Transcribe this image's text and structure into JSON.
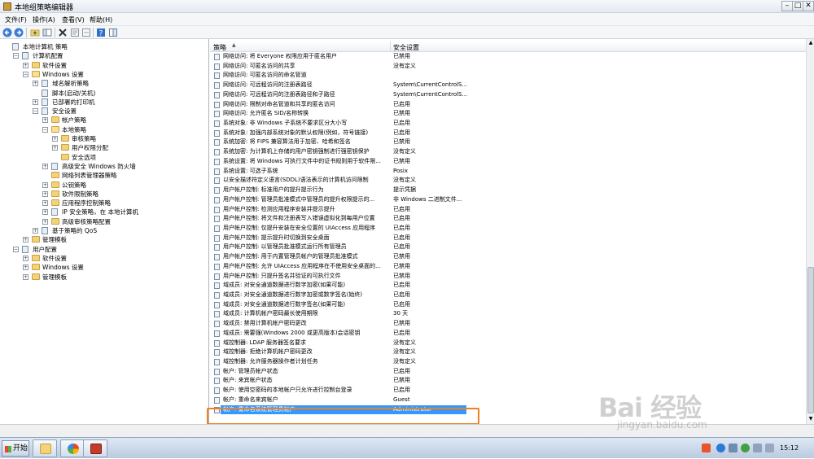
{
  "window": {
    "title": "本地组策略编辑器"
  },
  "menu": [
    "文件(F)",
    "操作(A)",
    "查看(V)",
    "帮助(H)"
  ],
  "tree": [
    {
      "label": "本地计算机 策略",
      "level": 0,
      "exp": "",
      "icon": "computer"
    },
    {
      "label": "计算机配置",
      "level": 1,
      "exp": "-",
      "icon": "computer"
    },
    {
      "label": "软件设置",
      "level": 2,
      "exp": "+",
      "icon": "folder"
    },
    {
      "label": "Windows 设置",
      "level": 2,
      "exp": "-",
      "icon": "folder-open"
    },
    {
      "label": "域名解析策略",
      "level": 3,
      "exp": "+",
      "icon": "gen"
    },
    {
      "label": "脚本(启动/关机)",
      "level": 3,
      "exp": "",
      "icon": "gen"
    },
    {
      "label": "已部署的打印机",
      "level": 3,
      "exp": "+",
      "icon": "gen"
    },
    {
      "label": "安全设置",
      "level": 3,
      "exp": "-",
      "icon": "gen"
    },
    {
      "label": "帐户策略",
      "level": 4,
      "exp": "+",
      "icon": "folder"
    },
    {
      "label": "本地策略",
      "level": 4,
      "exp": "-",
      "icon": "folder-open"
    },
    {
      "label": "审核策略",
      "level": 5,
      "exp": "+",
      "icon": "folder"
    },
    {
      "label": "用户权限分配",
      "level": 5,
      "exp": "+",
      "icon": "folder"
    },
    {
      "label": "安全选项",
      "level": 5,
      "exp": "",
      "icon": "folder"
    },
    {
      "label": "高级安全 Windows 防火墙",
      "level": 4,
      "exp": "+",
      "icon": "gen"
    },
    {
      "label": "网络列表管理器策略",
      "level": 4,
      "exp": "",
      "icon": "folder"
    },
    {
      "label": "公钥策略",
      "level": 4,
      "exp": "+",
      "icon": "folder"
    },
    {
      "label": "软件限制策略",
      "level": 4,
      "exp": "+",
      "icon": "folder"
    },
    {
      "label": "应用程序控制策略",
      "level": 4,
      "exp": "+",
      "icon": "folder"
    },
    {
      "label": "IP 安全策略，在 本地计算机",
      "level": 4,
      "exp": "+",
      "icon": "gen"
    },
    {
      "label": "高级审核策略配置",
      "level": 4,
      "exp": "+",
      "icon": "folder"
    },
    {
      "label": "基于策略的 QoS",
      "level": 3,
      "exp": "+",
      "icon": "gen"
    },
    {
      "label": "管理模板",
      "level": 2,
      "exp": "+",
      "icon": "folder"
    },
    {
      "label": "用户配置",
      "level": 1,
      "exp": "-",
      "icon": "gen"
    },
    {
      "label": "软件设置",
      "level": 2,
      "exp": "+",
      "icon": "folder"
    },
    {
      "label": "Windows 设置",
      "level": 2,
      "exp": "+",
      "icon": "folder"
    },
    {
      "label": "管理模板",
      "level": 2,
      "exp": "+",
      "icon": "folder"
    }
  ],
  "list": {
    "col_policy": "策略",
    "col_setting": "安全设置",
    "rows": [
      {
        "policy": "网络访问: 将 Everyone 权限应用于匿名用户",
        "setting": "已禁用"
      },
      {
        "policy": "网络访问: 可匿名访问的共享",
        "setting": "没有定义"
      },
      {
        "policy": "网络访问: 可匿名访问的命名管道",
        "setting": ""
      },
      {
        "policy": "网络访问: 可远程访问的注册表路径",
        "setting": "System\\CurrentControlS..."
      },
      {
        "policy": "网络访问: 可远程访问的注册表路径和子路径",
        "setting": "System\\CurrentControlS..."
      },
      {
        "policy": "网络访问: 限制对命名管道和共享的匿名访问",
        "setting": "已启用"
      },
      {
        "policy": "网络访问: 允许匿名 SID/名称转换",
        "setting": "已禁用"
      },
      {
        "policy": "系统对象: 非 Windows 子系统不要求区分大小写",
        "setting": "已启用"
      },
      {
        "policy": "系统对象: 加强内部系统对象的默认权限(例如，符号链接)",
        "setting": "已启用"
      },
      {
        "policy": "系统加密: 将 FIPS 兼容算法用于加密、哈希和签名",
        "setting": "已禁用"
      },
      {
        "policy": "系统加密: 为计算机上存储的用户密钥强制进行强密钥保护",
        "setting": "没有定义"
      },
      {
        "policy": "系统设置: 将 Windows 可执行文件中的证书规则用于软件限...",
        "setting": "已禁用"
      },
      {
        "policy": "系统设置: 可选子系统",
        "setting": "Posix"
      },
      {
        "policy": "以安全描述符定义语言(SDDL)语法表示的计算机访问限制",
        "setting": "没有定义"
      },
      {
        "policy": "用户帐户控制: 标准用户的提升提示行为",
        "setting": "提示凭据"
      },
      {
        "policy": "用户帐户控制: 管理员批准模式中管理员的提升权限提示的...",
        "setting": "非 Windows 二进制文件..."
      },
      {
        "policy": "用户帐户控制: 检测应用程序安装并提示提升",
        "setting": "已启用"
      },
      {
        "policy": "用户帐户控制: 将文件和注册表写入错误虚拟化到每用户位置",
        "setting": "已启用"
      },
      {
        "policy": "用户帐户控制: 仅提升安装在安全位置的 UIAccess 应用程序",
        "setting": "已启用"
      },
      {
        "policy": "用户帐户控制: 提示提升时切换到安全桌面",
        "setting": "已启用"
      },
      {
        "policy": "用户帐户控制: 以管理员批准模式运行所有管理员",
        "setting": "已启用"
      },
      {
        "policy": "用户帐户控制: 用于内置管理员帐户的管理员批准模式",
        "setting": "已禁用"
      },
      {
        "policy": "用户帐户控制: 允许 UIAccess 应用程序在不使用安全桌面的...",
        "setting": "已禁用"
      },
      {
        "policy": "用户帐户控制: 只提升签名并验证的可执行文件",
        "setting": "已禁用"
      },
      {
        "policy": "域成员: 对安全通道数据进行数字加密(如果可能)",
        "setting": "已启用"
      },
      {
        "policy": "域成员: 对安全通道数据进行数字加密或数字签名(始终)",
        "setting": "已启用"
      },
      {
        "policy": "域成员: 对安全通道数据进行数字签名(如果可能)",
        "setting": "已启用"
      },
      {
        "policy": "域成员: 计算机帐户密码最长使用期限",
        "setting": "30 天"
      },
      {
        "policy": "域成员: 禁用计算机帐户密码更改",
        "setting": "已禁用"
      },
      {
        "policy": "域成员: 需要强(Windows 2000 或更高版本)会话密钥",
        "setting": "已启用"
      },
      {
        "policy": "域控制器: LDAP 服务器签名要求",
        "setting": "没有定义"
      },
      {
        "policy": "域控制器: 拒绝计算机帐户密码更改",
        "setting": "没有定义"
      },
      {
        "policy": "域控制器: 允许服务器操作者计划任务",
        "setting": "没有定义"
      },
      {
        "policy": "帐户: 管理员帐户状态",
        "setting": "已启用"
      },
      {
        "policy": "帐户: 来宾帐户状态",
        "setting": "已禁用"
      },
      {
        "policy": "帐户: 使用空密码的本地帐户只允许进行控制台登录",
        "setting": "已启用"
      },
      {
        "policy": "帐户: 重命名来宾帐户",
        "setting": "Guest"
      },
      {
        "policy": "帐户: 重命名系统管理员帐户",
        "setting": "Administrator"
      }
    ]
  },
  "taskbar": {
    "start_label": "开始",
    "clock": "15:12"
  },
  "watermark": {
    "logo": "Bai 经验",
    "url": "jingyan.baidu.com"
  },
  "colors": {
    "selection": "#3399ff",
    "highlight_box": "#f08020"
  }
}
